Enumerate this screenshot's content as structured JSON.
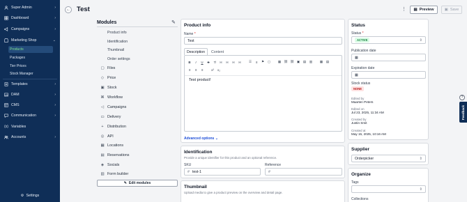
{
  "sidebar": {
    "items": [
      {
        "label": "Super Admin",
        "icon": "user-icon"
      },
      {
        "label": "Dashboard",
        "icon": "grid-icon"
      },
      {
        "label": "Campaigns",
        "icon": "megaphone-icon"
      },
      {
        "label": "Marketing Shop",
        "icon": "shop-icon"
      }
    ],
    "shop_sub": [
      "Products",
      "Packages",
      "Tier Prices",
      "Stock Manager"
    ],
    "items2": [
      {
        "label": "Templates",
        "icon": "template-icon"
      },
      {
        "label": "DAM",
        "icon": "image-icon"
      },
      {
        "label": "CMS",
        "icon": "layout-icon"
      },
      {
        "label": "Communication",
        "icon": "chat-icon"
      },
      {
        "label": "Variables",
        "icon": "braces-icon"
      },
      {
        "label": "Accounts",
        "icon": "users-icon"
      }
    ],
    "settings": "Settings"
  },
  "header": {
    "title": "Test",
    "preview": "Preview",
    "save": "Save"
  },
  "modules": {
    "title": "Modules",
    "product_sub": [
      "Product info",
      "Identification",
      "Thumbnail",
      "Order settings"
    ],
    "items": [
      {
        "label": "Files",
        "icon": "file-icon"
      },
      {
        "label": "Price",
        "icon": "tag-icon"
      },
      {
        "label": "Stock",
        "icon": "box-icon"
      },
      {
        "label": "Workflow",
        "icon": "workflow-icon"
      },
      {
        "label": "Campaigns",
        "icon": "megaphone-icon"
      },
      {
        "label": "Delivery",
        "icon": "truck-icon"
      },
      {
        "label": "Distribution",
        "icon": "plus-icon"
      },
      {
        "label": "API",
        "icon": "api-icon"
      },
      {
        "label": "Locations",
        "icon": "map-icon"
      },
      {
        "label": "Reservations",
        "icon": "calendar-icon"
      },
      {
        "label": "Socials",
        "icon": "share-icon"
      },
      {
        "label": "Form builder",
        "icon": "form-icon"
      }
    ],
    "edit_button": "Edit modules"
  },
  "product_info": {
    "title": "Product info",
    "name_label": "Name",
    "name_value": "Test",
    "tabs": [
      "Description",
      "Content"
    ],
    "editor_text": "Test product!",
    "advanced": "Advanced options"
  },
  "identification": {
    "title": "Identification",
    "desc": "Provide a unique identifier for this product and an optional reference.",
    "sku_label": "SKU",
    "sku_value": "test-1",
    "ref_label": "Reference",
    "ref_value": ""
  },
  "thumbnail": {
    "title": "Thumbnail",
    "desc": "Upload media to give a product preview on the overview and detail page."
  },
  "status": {
    "title": "Status",
    "status_label": "Status",
    "status_value": "ACTIVE",
    "pub_label": "Publication date",
    "exp_label": "Expiration date",
    "stock_label": "Stock status",
    "stock_value": "NONE",
    "edited_by_label": "Edited by",
    "edited_by": "Maarten Peters",
    "edited_on_label": "Edited on",
    "edited_on": "Jul 23, 2025, 11:34 AM",
    "created_by_label": "Created by",
    "created_by": "Justin Smit",
    "created_at_label": "Created at",
    "created_at": "May 15, 2025, 10:16 AM",
    "colors": {
      "active_bg": "#dcfce7",
      "active_fg": "#15803d",
      "none_bg": "#fee2e2",
      "none_fg": "#b91c1c"
    }
  },
  "supplier": {
    "title": "Supplier",
    "value": "Orderpicker"
  },
  "organize": {
    "title": "Organize",
    "tags_label": "Tags",
    "collections_label": "Collections"
  },
  "feedback": "Feedback",
  "colors": {
    "sidebar": "#0f2e57",
    "accent_green": "#7ee08f",
    "link_blue": "#1d4ed8"
  }
}
